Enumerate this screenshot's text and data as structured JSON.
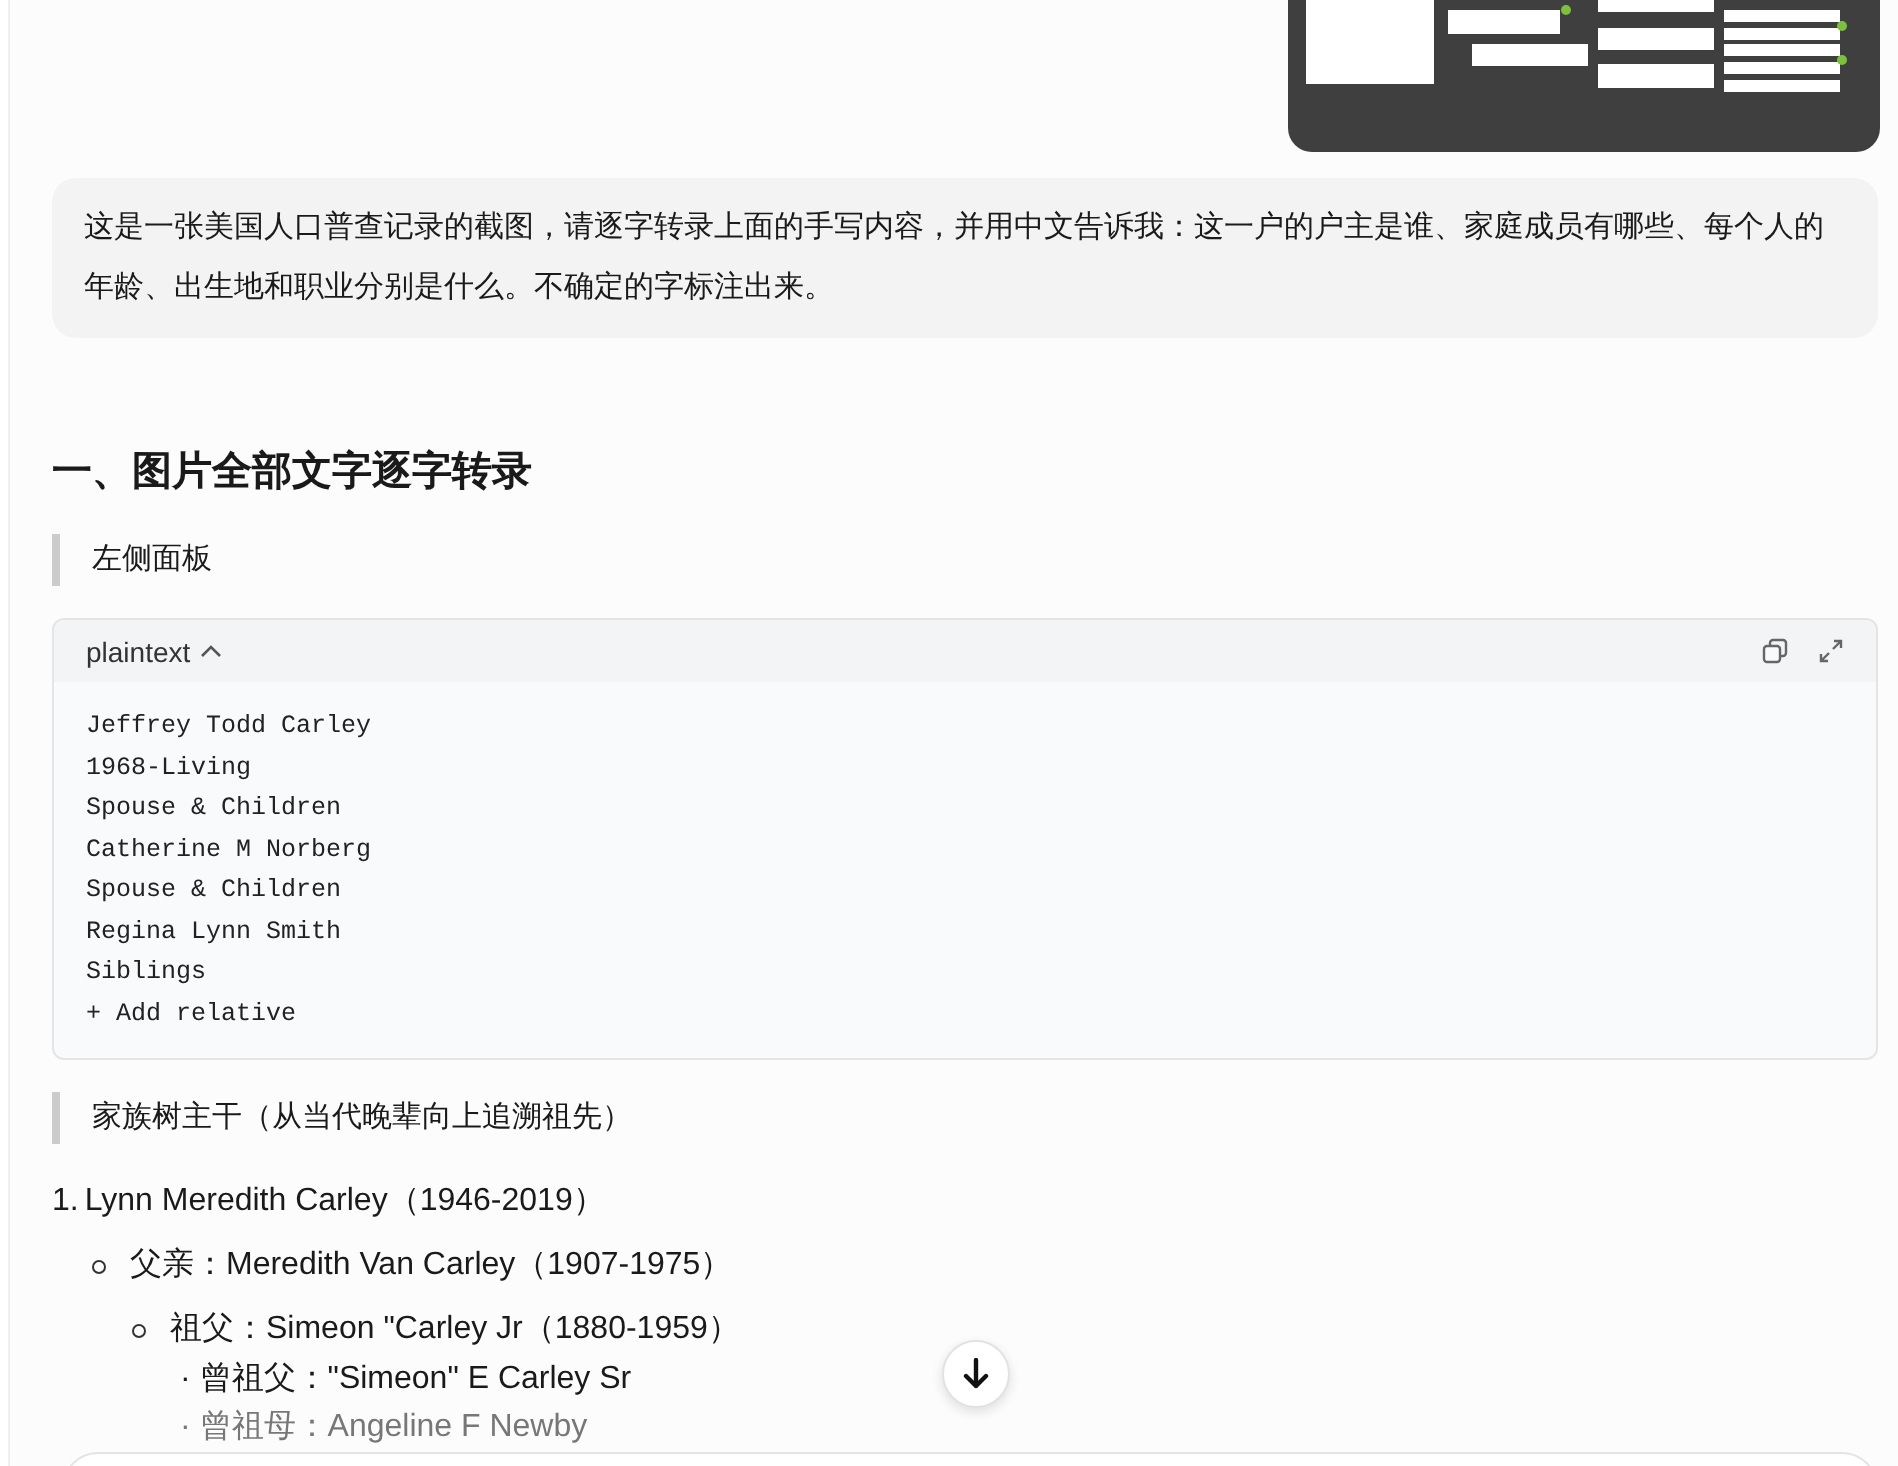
{
  "user_message": {
    "text": "这是一张美国人口普查记录的截图，请逐字转录上面的手写内容，并用中文告诉我：这一户的户主是谁、家庭成员有哪些、每个人的年龄、出生地和职业分别是什么。不确定的字标注出来。"
  },
  "answer": {
    "heading": "一、图片全部文字逐字转录",
    "quote_1": "左侧面板",
    "code_block": {
      "language": "plaintext",
      "expanded": true,
      "lines": [
        "Jeffrey Todd Carley",
        "1968-Living",
        "Spouse & Children",
        "Catherine M Norberg",
        "Spouse & Children",
        "Regina Lynn Smith",
        "Siblings",
        "+ Add relative"
      ]
    },
    "quote_2": "家族树主干（从当代晚辈向上追溯祖先）",
    "tree": [
      {
        "number": "1.",
        "text": "Lynn Meredith Carley（1946-2019）",
        "children": [
          {
            "text": "父亲：Meredith Van Carley（1907-1975）",
            "children": [
              {
                "text": "祖父：Simeon \"Carley Jr（1880-1959）",
                "children": [
                  {
                    "text": "· 曾祖父：\"Simeon\" E Carley Sr"
                  },
                  {
                    "text": "· 曾祖母：Angeline F Newby"
                  }
                ]
              }
            ]
          }
        ]
      }
    ]
  }
}
